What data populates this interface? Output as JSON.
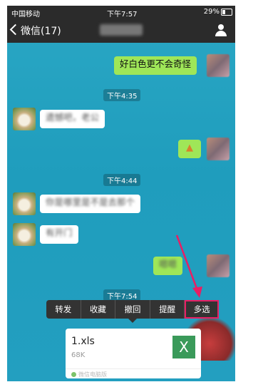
{
  "status_bar": {
    "carrier": "中国移动",
    "time": "下午7:57",
    "battery": "29%"
  },
  "nav": {
    "back_label": "微信(17)"
  },
  "messages": {
    "m1_text": "好白色更不会奇怪",
    "t1": "下午4:35",
    "m2_text": "遗憾吧，老公",
    "t2": "下午4:44",
    "m4_text": "你是哪里是不是去那个",
    "m5_text": "有开门",
    "m6_text": "嗯嗯",
    "t3": "下午7:54"
  },
  "context_menu": {
    "items": [
      "转发",
      "收藏",
      "撤回",
      "提醒",
      "多选"
    ]
  },
  "file_card": {
    "filename": "1.xls",
    "filesize": "68K",
    "icon_letter": "X",
    "source": "微信电脑版"
  },
  "colors": {
    "sent_bubble": "#9fe658",
    "highlight": "#e91e63",
    "excel": "#3a9a5a"
  }
}
